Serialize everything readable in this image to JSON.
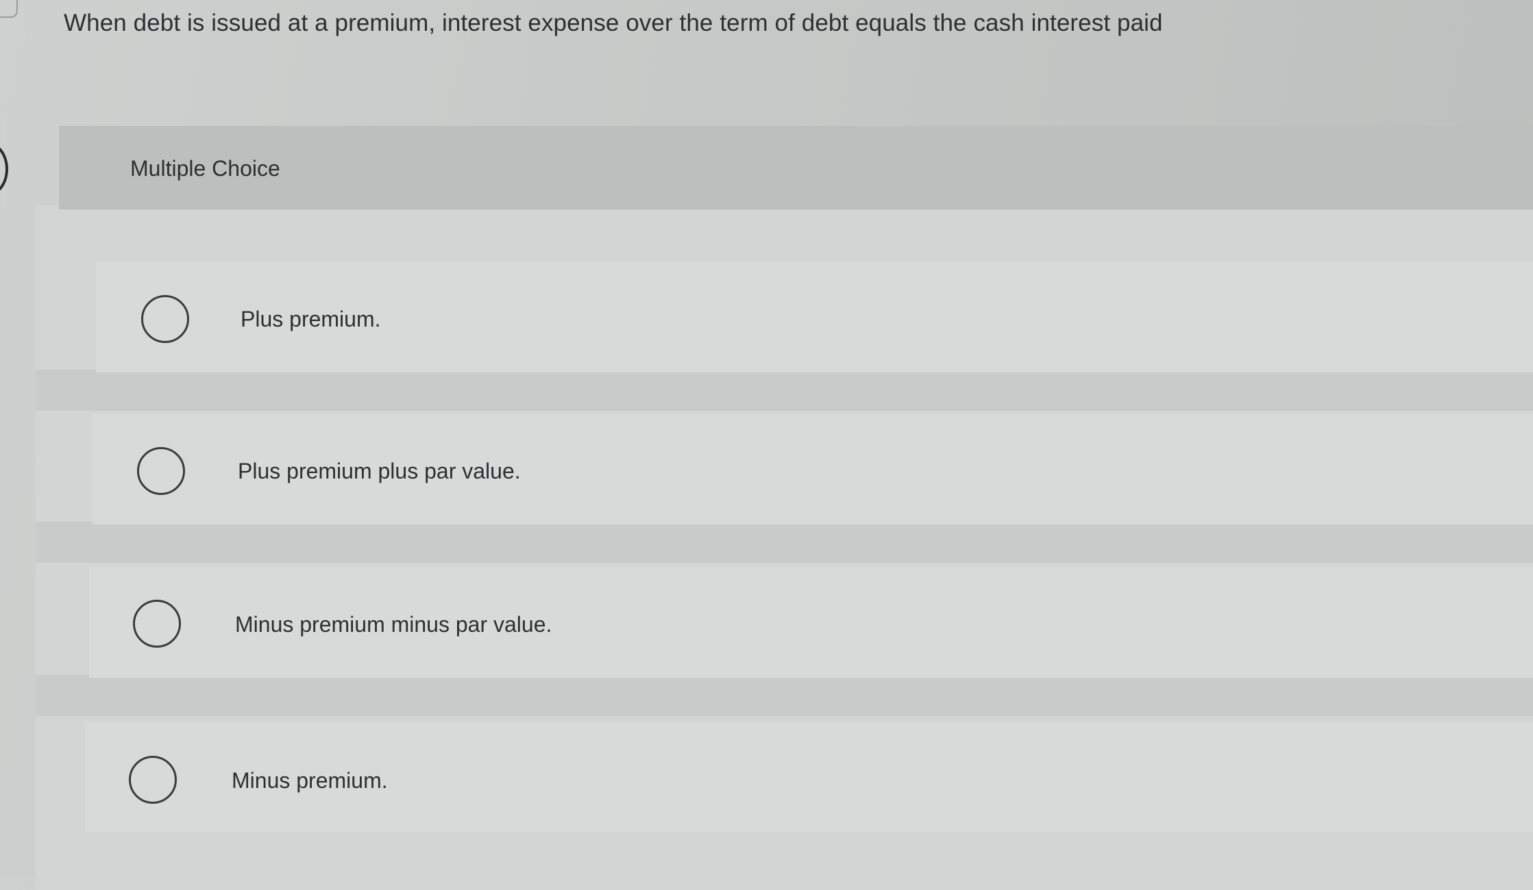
{
  "question": {
    "text": "When debt is issued at a premium, interest expense over the term of debt equals the cash interest paid"
  },
  "panel": {
    "header_label": "Multiple Choice"
  },
  "options": [
    {
      "label": "Plus premium.",
      "selected": false
    },
    {
      "label": "Plus premium plus par value.",
      "selected": false
    },
    {
      "label": "Minus premium minus par value.",
      "selected": false
    },
    {
      "label": "Minus premium.",
      "selected": false
    }
  ]
}
